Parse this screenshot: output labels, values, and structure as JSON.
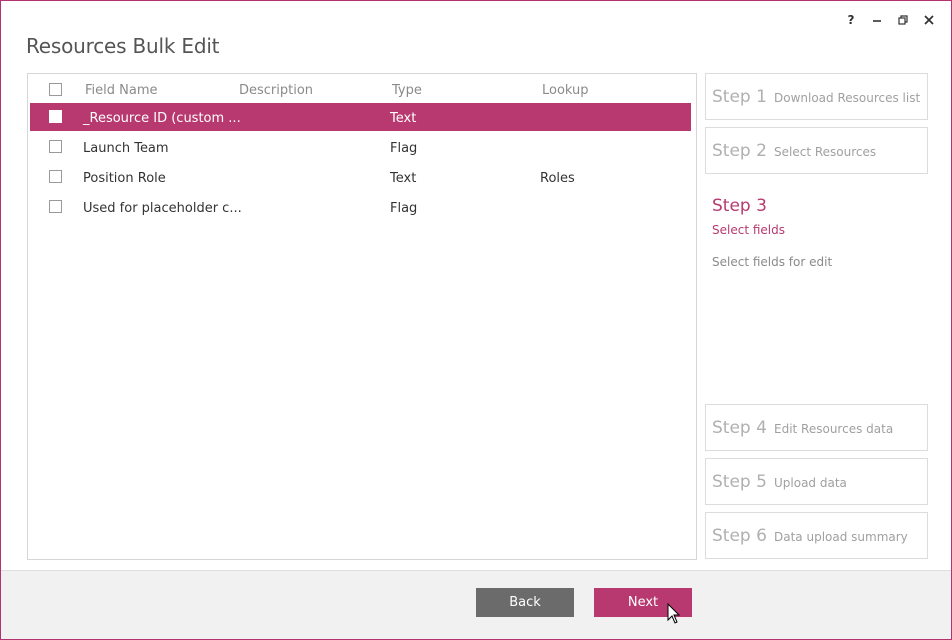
{
  "window": {
    "title": "Resources Bulk Edit",
    "controls": [
      "help-icon",
      "minimize-icon",
      "restore-icon",
      "close-icon"
    ],
    "help_label": "?"
  },
  "grid": {
    "columns": [
      "Field Name",
      "Description",
      "Type",
      "Lookup"
    ],
    "rows": [
      {
        "field_name": "_Resource ID (custom ...",
        "description": "",
        "type": "Text",
        "lookup": "",
        "selected": true
      },
      {
        "field_name": "Launch Team",
        "description": "",
        "type": "Flag",
        "lookup": "",
        "selected": false
      },
      {
        "field_name": "Position Role",
        "description": "",
        "type": "Text",
        "lookup": "Roles",
        "selected": false
      },
      {
        "field_name": "Used for placeholder c...",
        "description": "",
        "type": "Flag",
        "lookup": "",
        "selected": false
      }
    ]
  },
  "steps": [
    {
      "num": "Step 1",
      "label": "Download Resources list"
    },
    {
      "num": "Step 2",
      "label": "Select Resources"
    },
    {
      "num": "Step 3",
      "label": "Select fields",
      "description": "Select fields for edit",
      "active": true
    },
    {
      "num": "Step 4",
      "label": "Edit Resources data"
    },
    {
      "num": "Step 5",
      "label": "Upload data"
    },
    {
      "num": "Step 6",
      "label": "Data upload summary"
    }
  ],
  "footer": {
    "back_label": "Back",
    "next_label": "Next"
  },
  "colors": {
    "accent": "#b8396f",
    "back_button": "#6b6b6b",
    "footer_bg": "#f1f1f1"
  }
}
